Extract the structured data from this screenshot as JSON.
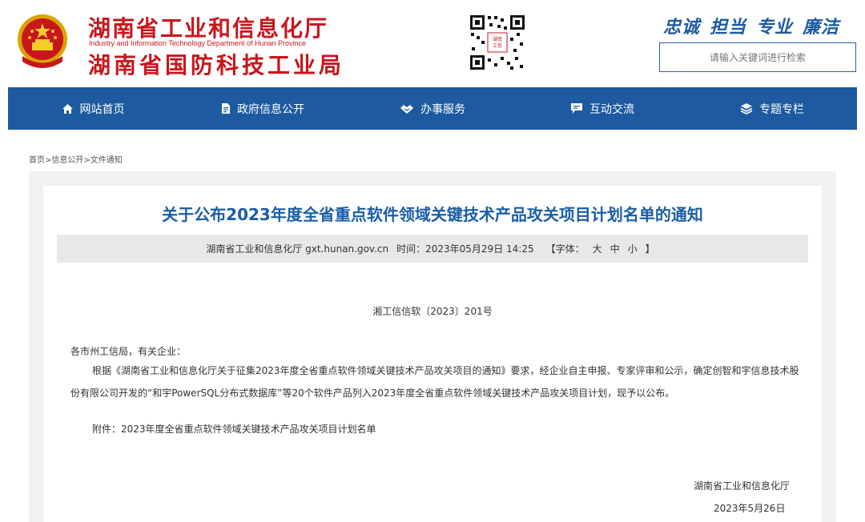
{
  "header": {
    "org_name_1": "湖南省工业和信息化厅",
    "org_name_en": "Industry and Information Technology Department of Hunan Province",
    "org_name_2": "湖南省国防科技工业局",
    "slogan": [
      "忠诚",
      "担当",
      "专业",
      "廉洁"
    ],
    "search_placeholder": "请输入关键词进行检索"
  },
  "nav": [
    {
      "label": "网站首页",
      "icon": "home-icon"
    },
    {
      "label": "政府信息公开",
      "icon": "document-icon"
    },
    {
      "label": "办事服务",
      "icon": "handshake-icon"
    },
    {
      "label": "互动交流",
      "icon": "chat-icon"
    },
    {
      "label": "专题专栏",
      "icon": "layers-icon"
    }
  ],
  "breadcrumb": {
    "home": "首页",
    "sep": ">",
    "info": "信息公开",
    "current": "文件通知"
  },
  "article": {
    "title": "关于公布2023年度全省重点软件领域关键技术产品攻关项目计划名单的通知",
    "source": "湖南省工业和信息化厅 gxt.hunan.gov.cn",
    "time_label": "时间：2023年05月29日 14:25",
    "font_label_open": "【字体：",
    "font_large": "大",
    "font_medium": "中",
    "font_small": "小",
    "font_label_close": "】",
    "doc_number": "湘工信信软〔2023〕201号",
    "salutation": "各市州工信局，有关企业：",
    "paragraph": "根据《湖南省工业和信息化厅关于征集2023年度全省重点软件领域关键技术产品攻关项目的通知》要求，经企业自主申报、专家评审和公示，确定创智和宇信息技术股份有限公司开发的“和宇PowerSQL分布式数据库”等20个软件产品列入2023年度全省重点软件领域关键技术产品攻关项目计划，现予以公布。",
    "attachment": "附件：2023年度全省重点软件领域关键技术产品攻关项目计划名单",
    "signature": "湖南省工业和信息化厅",
    "date": "2023年5月26日"
  },
  "colors": {
    "brand_red": "#c8161d",
    "nav_blue": "#1d5aa0",
    "title_blue": "#1a5ea6"
  }
}
